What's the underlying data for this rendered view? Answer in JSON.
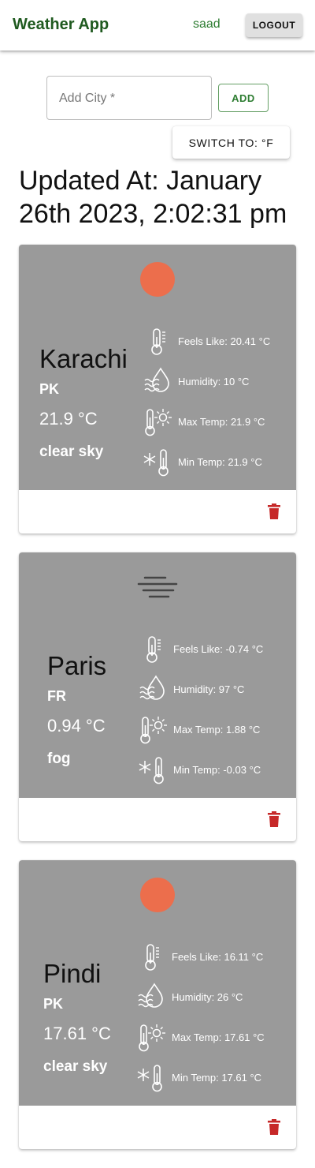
{
  "header": {
    "title": "Weather App",
    "username": "saad",
    "logout_label": "LOGOUT"
  },
  "add_city": {
    "placeholder": "Add City *",
    "value": "",
    "add_label": "ADD"
  },
  "switch_label": "SWITCH TO: °F",
  "updated_at": "Updated At: January 26th 2023, 2:02:31 pm",
  "colors": {
    "brand": "#1f5a1f",
    "accent": "#2e7d32",
    "card": "#9a9a9a",
    "sun": "#ec6e4c",
    "delete": "#c62828"
  },
  "cards": [
    {
      "city": "Karachi",
      "country": "PK",
      "temp": "21.9 °C",
      "description": "clear sky",
      "icon": "sun-icon",
      "feels_like": "Feels Like: 20.41 °C",
      "humidity": "Humidity: 10 °C",
      "max_temp": "Max Temp: 21.9 °C",
      "min_temp": "Min Temp: 21.9 °C"
    },
    {
      "city": "Paris",
      "country": "FR",
      "temp": "0.94 °C",
      "description": "fog",
      "icon": "fog-icon",
      "feels_like": "Feels Like: -0.74 °C",
      "humidity": "Humidity: 97 °C",
      "max_temp": "Max Temp: 1.88 °C",
      "min_temp": "Min Temp: -0.03 °C"
    },
    {
      "city": "Pindi",
      "country": "PK",
      "temp": "17.61 °C",
      "description": "clear sky",
      "icon": "sun-icon",
      "feels_like": "Feels Like: 16.11 °C",
      "humidity": "Humidity: 26 °C",
      "max_temp": "Max Temp: 17.61 °C",
      "min_temp": "Min Temp: 17.61 °C"
    }
  ]
}
